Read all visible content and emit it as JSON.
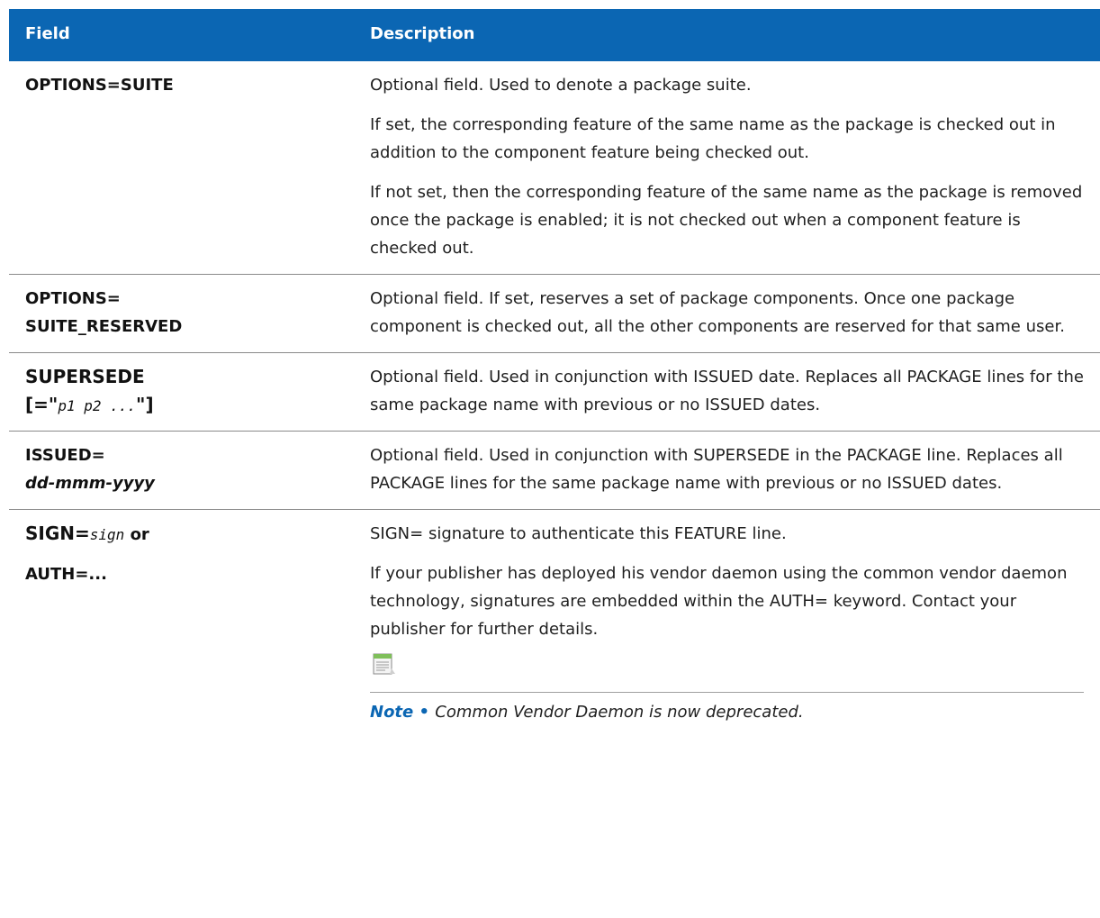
{
  "header": {
    "field": "Field",
    "description": "Description"
  },
  "rows": [
    {
      "field": "OPTIONS=SUITE",
      "desc": [
        "Optional field. Used to denote a package suite.",
        "If set, the corresponding feature of the same name as the package is checked out in addition to the component feature being checked out.",
        "If not set, then the corresponding feature of the same name as the package is removed once the package is enabled; it is not checked out when a component feature is checked out."
      ]
    },
    {
      "field_line1": "OPTIONS=",
      "field_line2": "SUITE_RESERVED",
      "desc": [
        "Optional field. If set, reserves a set of package components. Once one package component is checked out, all the other components are reserved for that same user."
      ]
    },
    {
      "field_line1": "SUPERSEDE",
      "field_line2_open": "[=\"",
      "field_line2_italic": "p1 p2 ...",
      "field_line2_close": "\"]",
      "desc": [
        "Optional field. Used in conjunction with ISSUED date. Replaces all PACKAGE lines for the same package name with previous or no ISSUED dates."
      ]
    },
    {
      "field_line1": "ISSUED=",
      "field_line2": "dd-mmm-yyyy",
      "desc": [
        "Optional field. Used in conjunction with SUPERSEDE in the PACKAGE line. Replaces all PACKAGE lines for the same package name with previous or no ISSUED dates."
      ]
    },
    {
      "field_a": "SIGN=",
      "field_a_italic": "sign",
      "field_a_or": " or",
      "field_b": "AUTH=...",
      "desc": [
        "SIGN= signature to authenticate this FEATURE line.",
        "If your publisher has deployed his vendor daemon using the common vendor daemon technology, signatures are embedded within the AUTH= keyword. Contact your publisher for further details."
      ],
      "note_label": "Note",
      "note_sep": " • ",
      "note_text": "Common Vendor Daemon is now deprecated.",
      "note_icon": "notepad-icon"
    }
  ]
}
